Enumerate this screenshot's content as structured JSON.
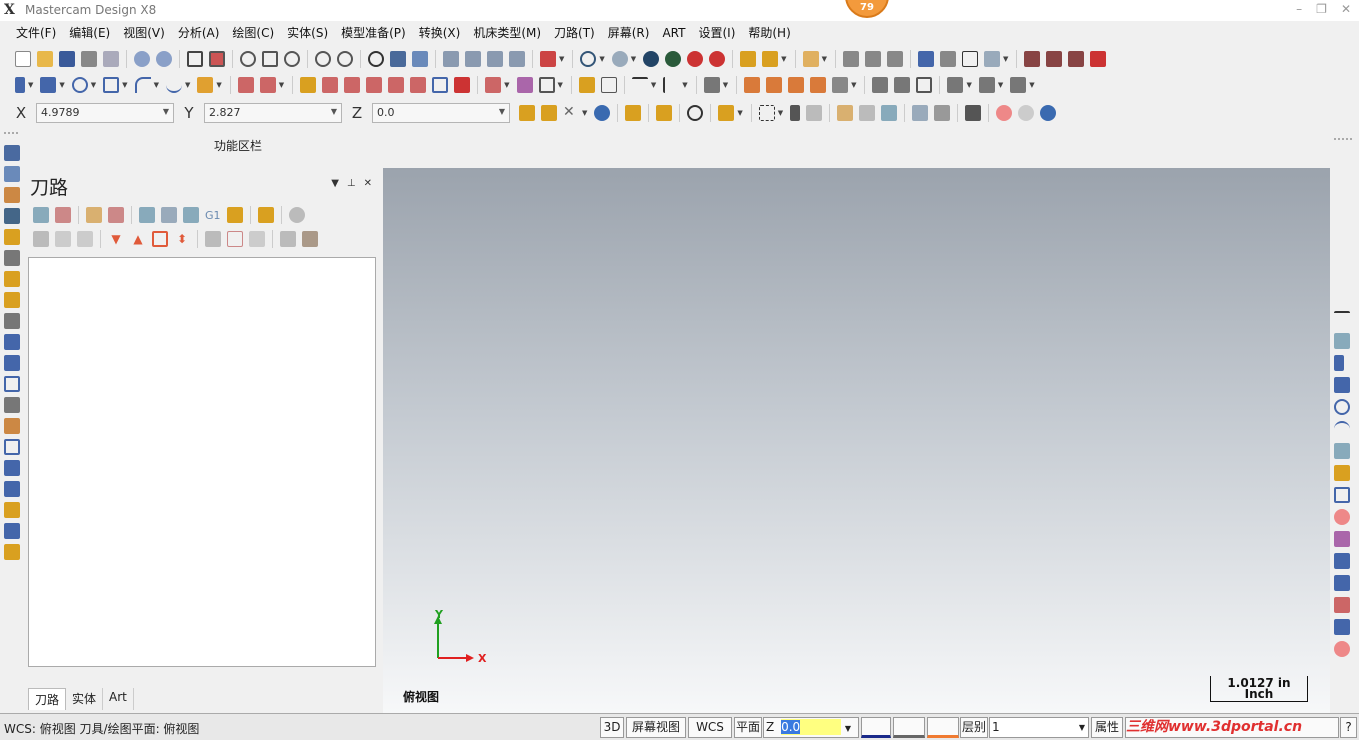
{
  "window": {
    "title": "Mastercam Design X8",
    "notification_badge": "79"
  },
  "menu": [
    "文件(F)",
    "编辑(E)",
    "视图(V)",
    "分析(A)",
    "绘图(C)",
    "实体(S)",
    "模型准备(P)",
    "转换(X)",
    "机床类型(M)",
    "刀路(T)",
    "屏幕(R)",
    "ART",
    "设置(I)",
    "帮助(H)"
  ],
  "coords": {
    "x_label": "X",
    "x_value": "4.9789",
    "y_label": "Y",
    "y_value": "2.827",
    "z_label": "Z",
    "z_value": "0.0"
  },
  "ribbon_label": "功能区栏",
  "panel": {
    "title": "刀路",
    "tabs": [
      "刀路",
      "实体",
      "Art"
    ],
    "toolbar_text": "G1"
  },
  "viewport": {
    "view_name": "俯视图",
    "scale_value": "1.0127 in",
    "scale_unit": "Inch",
    "axis_x": "X",
    "axis_y": "Y"
  },
  "status": {
    "left_text": "WCS: 俯视图  刀具/绘图平面: 俯视图",
    "btn_3d": "3D",
    "btn_screen_view": "屏幕视图",
    "btn_wcs": "WCS",
    "btn_plane": "平面",
    "z_label": "Z",
    "z_value": "0.0",
    "layer_label": "层别",
    "layer_value": "1",
    "attr_label": "属性",
    "help": "?",
    "watermark": "三维网www.3dportal.cn"
  },
  "colors": {
    "accent": "#f39a3c",
    "viewport_top": "#9ba3ad",
    "viewport_bottom": "#f7f8f9",
    "axis_x": "#e02020",
    "axis_y": "#20a020"
  }
}
